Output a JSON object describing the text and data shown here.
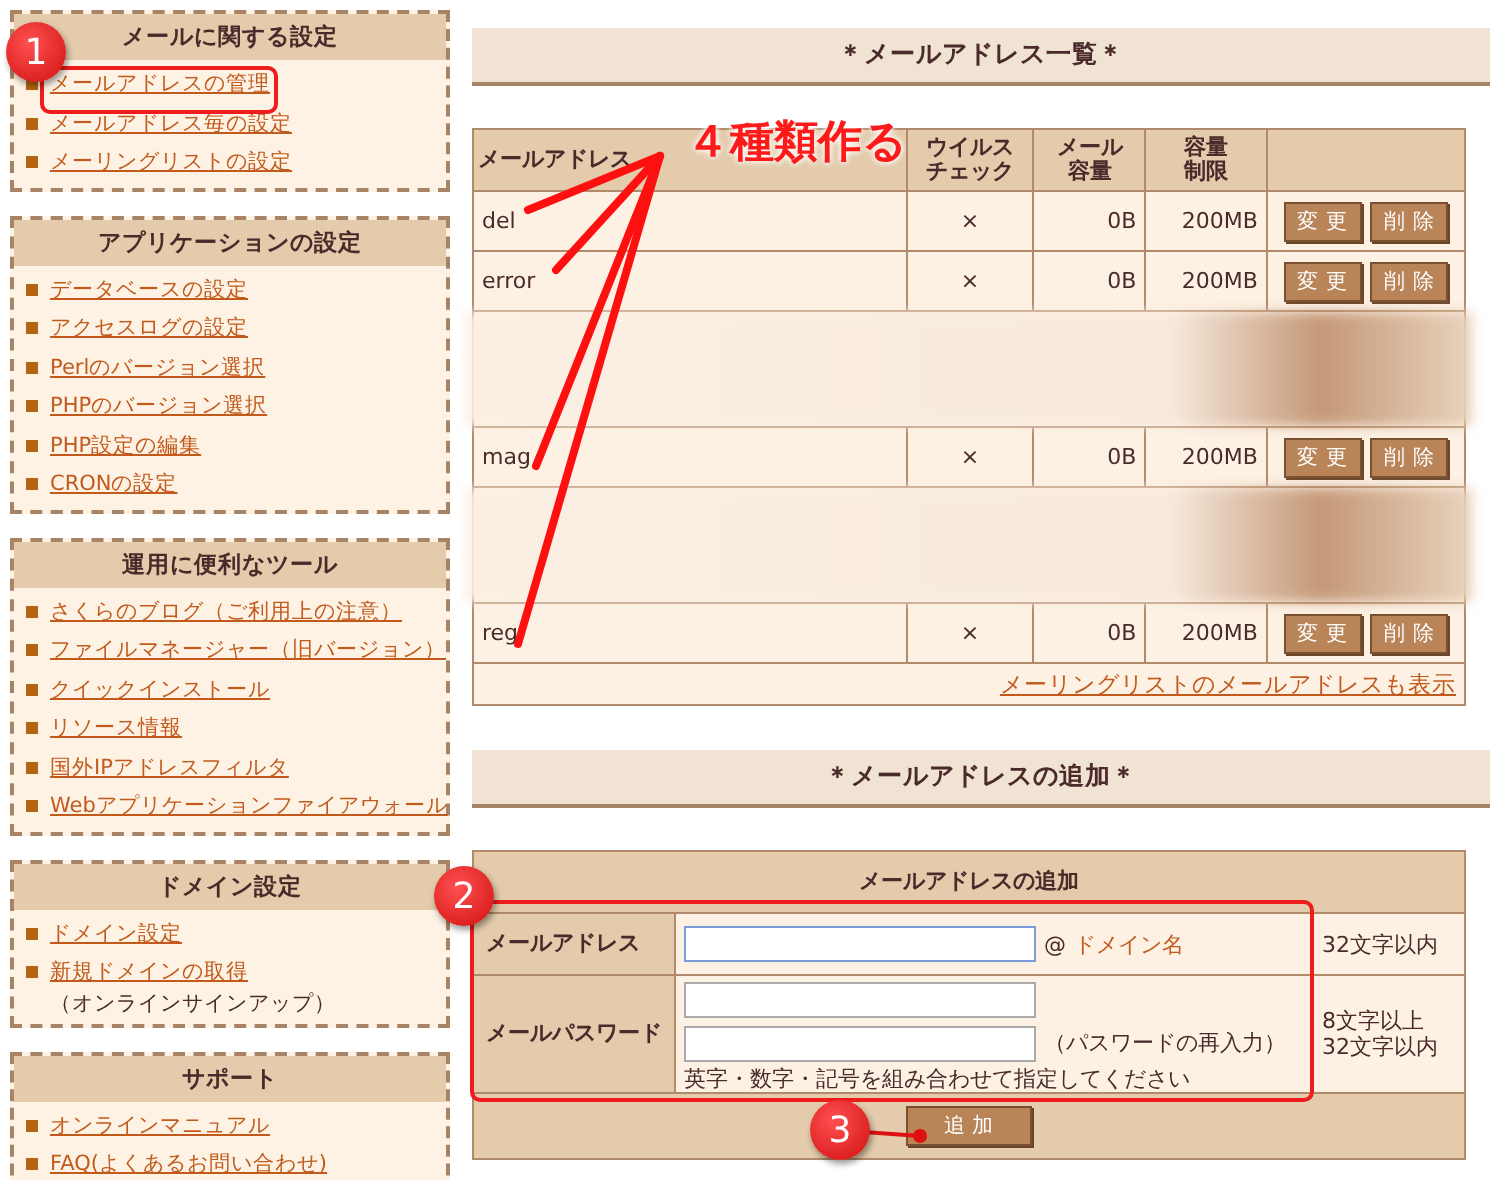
{
  "sidebar": [
    {
      "title": "メールに関する設定",
      "items": [
        {
          "label": "メールアドレスの管理"
        },
        {
          "label": "メールアドレス毎の設定"
        },
        {
          "label": "メーリングリストの設定"
        }
      ]
    },
    {
      "title": "アプリケーションの設定",
      "items": [
        {
          "label": "データベースの設定"
        },
        {
          "label": "アクセスログの設定"
        },
        {
          "label": "Perlのバージョン選択"
        },
        {
          "label": "PHPのバージョン選択"
        },
        {
          "label": "PHP設定の編集"
        },
        {
          "label": "CRONの設定"
        }
      ]
    },
    {
      "title": "運用に便利なツール",
      "items": [
        {
          "label": "さくらのブログ（ご利用上の注意）"
        },
        {
          "label": "ファイルマネージャー（旧バージョン）"
        },
        {
          "label": "クイックインストール"
        },
        {
          "label": "リソース情報"
        },
        {
          "label": "国外IPアドレスフィルタ"
        },
        {
          "label": "Webアプリケーションファイアウォール"
        }
      ]
    },
    {
      "title": "ドメイン設定",
      "items": [
        {
          "label": "ドメイン設定"
        },
        {
          "label": "新規ドメインの取得",
          "note": "（オンラインサインアップ）"
        }
      ]
    },
    {
      "title": "サポート",
      "items": [
        {
          "label": "オンラインマニュアル"
        },
        {
          "label": "FAQ(よくあるお問い合わせ)"
        }
      ]
    }
  ],
  "list_section": {
    "title": "＊メールアドレス一覧＊",
    "columns": [
      "メールアドレス",
      "ウイルスチェック",
      "メール容量",
      "容量制限",
      ""
    ],
    "rows": [
      {
        "kind": "entry",
        "address": "del",
        "virus": "×",
        "usage": "0B",
        "limit": "200MB",
        "actions": [
          "変 更",
          "削 除"
        ]
      },
      {
        "kind": "entry",
        "address": "error",
        "virus": "×",
        "usage": "0B",
        "limit": "200MB",
        "actions": [
          "変 更",
          "削 除"
        ]
      },
      {
        "kind": "blurred"
      },
      {
        "kind": "entry",
        "address": "mag",
        "virus": "×",
        "usage": "0B",
        "limit": "200MB",
        "actions": [
          "変 更",
          "削 除"
        ]
      },
      {
        "kind": "blurred"
      },
      {
        "kind": "entry",
        "address": "reg",
        "virus": "×",
        "usage": "0B",
        "limit": "200MB",
        "actions": [
          "変 更",
          "削 除"
        ]
      }
    ],
    "footer_link": "メーリングリストのメールアドレスも表示"
  },
  "add_section": {
    "title": "＊メールアドレスの追加＊",
    "form_title": "メールアドレスの追加",
    "address": {
      "label": "メールアドレス",
      "suffix_at": "@",
      "suffix_link": "ドメイン名",
      "note": "32文字以内"
    },
    "password": {
      "label": "メールパスワード",
      "reenter": "（パスワードの再入力）",
      "hint": "英字・数字・記号を組み合わせて指定してください",
      "note": "8文字以上\n32文字以内"
    },
    "submit": "追 加"
  },
  "annotations": {
    "callout": "４種類作る",
    "markers": [
      "1",
      "2",
      "3"
    ]
  }
}
